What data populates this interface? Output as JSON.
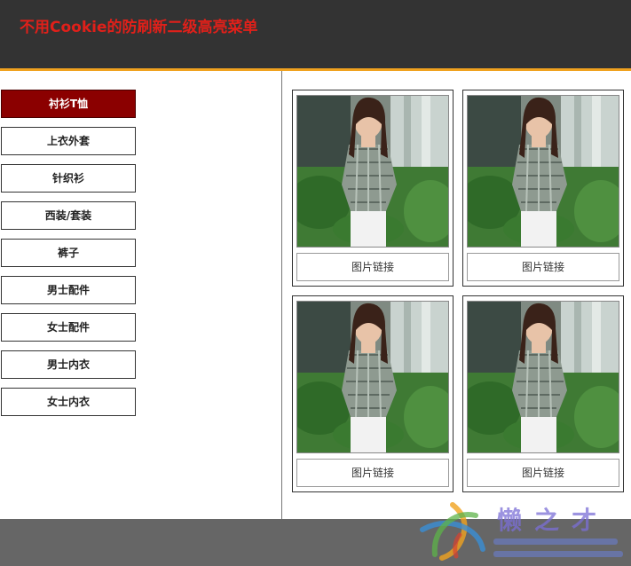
{
  "header": {
    "title": "不用Cookie的防刷新二级高亮菜单"
  },
  "sidebar": {
    "items": [
      {
        "label": "衬衫T恤",
        "active": true
      },
      {
        "label": "上衣外套",
        "active": false
      },
      {
        "label": "针织衫",
        "active": false
      },
      {
        "label": "西装/套装",
        "active": false
      },
      {
        "label": "裤子",
        "active": false
      },
      {
        "label": "男士配件",
        "active": false
      },
      {
        "label": "女士配件",
        "active": false
      },
      {
        "label": "男士内衣",
        "active": false
      },
      {
        "label": "女士内衣",
        "active": false
      }
    ]
  },
  "products": [
    {
      "link_label": "图片链接",
      "image": "woman-plaid-shirt-photo"
    },
    {
      "link_label": "图片链接",
      "image": "woman-plaid-shirt-photo"
    },
    {
      "link_label": "图片链接",
      "image": "woman-plaid-shirt-photo"
    },
    {
      "link_label": "图片链接",
      "image": "woman-plaid-shirt-photo"
    }
  ],
  "colors": {
    "header_bg": "#333333",
    "header_accent": "#f0a21f",
    "title": "#e0201a",
    "active_menu": "#8b0000",
    "footer_bg": "#666666"
  },
  "watermark": {
    "text": "懒之才",
    "icon": "colorful-swirl-logo-icon"
  }
}
